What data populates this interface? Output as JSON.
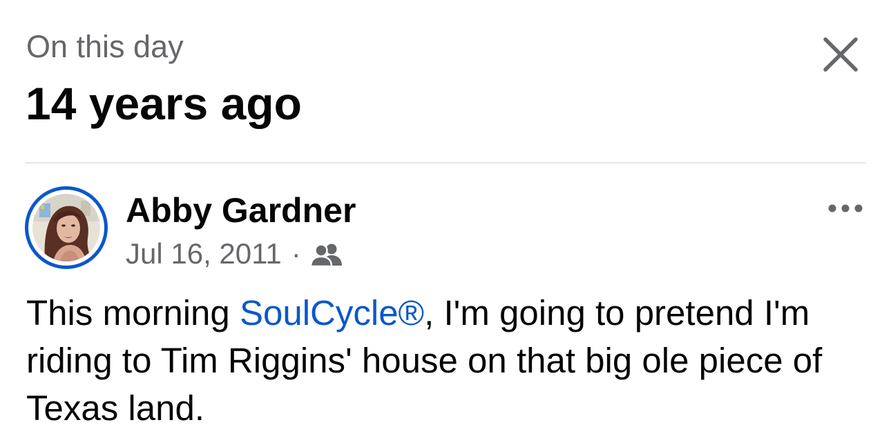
{
  "header": {
    "subtitle": "On this day",
    "title": "14 years ago",
    "close_icon": "close-icon"
  },
  "post": {
    "author": "Abby Gardner",
    "date": "Jul 16, 2011",
    "separator": "·",
    "audience_icon": "friends-icon",
    "more_icon": "more-options-icon",
    "text_before": "This morning ",
    "link_text": "SoulCycle®",
    "text_after": ", I'm going to pretend I'm riding to Tim Riggins' house on that big ole piece of Texas land."
  },
  "colors": {
    "avatar_ring": "#0a58ca",
    "link": "#0a58ca",
    "secondary_text": "#65676b",
    "primary_text": "#050505",
    "divider": "#e4e6eb"
  }
}
